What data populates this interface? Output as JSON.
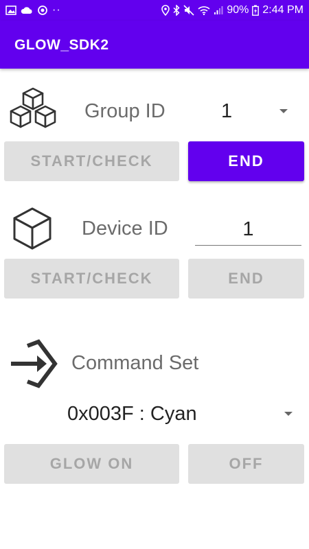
{
  "status_bar": {
    "battery_percent": "90%",
    "time": "2:44 PM",
    "left_icons": [
      "image-icon",
      "cloud-icon",
      "sync-icon",
      "more-dots-icon"
    ],
    "right_icons": [
      "location-icon",
      "bluetooth-icon",
      "mute-icon",
      "wifi-icon",
      "signal-icon",
      "battery-icon"
    ]
  },
  "app_bar": {
    "title": "GLOW_SDK2"
  },
  "group": {
    "icon": "cubes-icon",
    "label": "Group ID",
    "selected_value": "1",
    "start_label": "START/CHECK",
    "end_label": "END"
  },
  "device": {
    "icon": "cube-icon",
    "label": "Device ID",
    "input_value": "1",
    "start_label": "START/CHECK",
    "end_label": "END"
  },
  "command": {
    "icon": "login-arrow-icon",
    "label": "Command Set",
    "selected_value": "0x003F : Cyan",
    "glow_on_label": "GLOW ON",
    "off_label": "OFF"
  },
  "colors": {
    "accent": "#6200ee",
    "button_disabled_bg": "#e0e0e0",
    "button_disabled_text": "#a6a6a6",
    "label_text": "#6b6b6b"
  }
}
